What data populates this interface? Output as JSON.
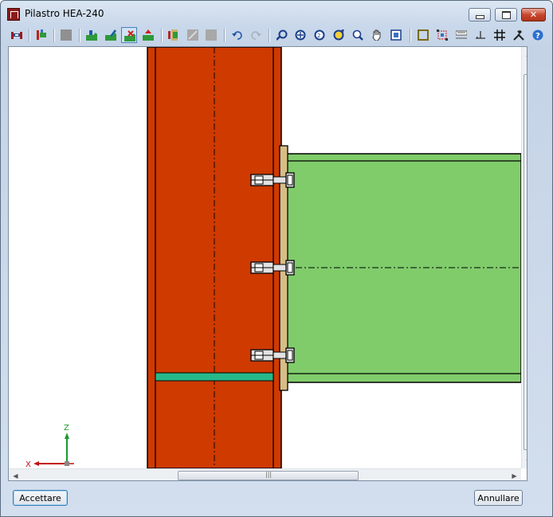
{
  "window": {
    "title": "Pilastro HEA-240"
  },
  "toolbar": {
    "icons": [
      "open-connection-icon",
      "edit-plate-icon",
      "gray-box-icon",
      "add-stiffener-icon",
      "edit-stiffener-icon",
      "delete-stiffener-icon",
      "move-stiffener-icon",
      "layers-icon",
      "disabled-icon-1",
      "disabled-icon-2",
      "undo-icon",
      "redo-icon",
      "rotate-view-icon",
      "zoom-all-icon",
      "zoom-2x-icon",
      "zoom-previous-icon",
      "zoom-window-icon",
      "pan-icon",
      "zoom-extents-icon",
      "frame-icon",
      "snap-icon",
      "dimensions-icon",
      "ground-icon",
      "grid-icon",
      "tools-icon",
      "help-icon"
    ]
  },
  "drawing": {
    "axis_z_label": "Z",
    "axis_x_label": "X",
    "colors": {
      "column": "#cf3a00",
      "beam": "#80cc6b",
      "end_plate": "#d7bd85",
      "stiffener": "#26b88a",
      "bolt": "#e0e0e0"
    }
  },
  "footer": {
    "accept_label": "Accettare",
    "cancel_label": "Annullare"
  }
}
